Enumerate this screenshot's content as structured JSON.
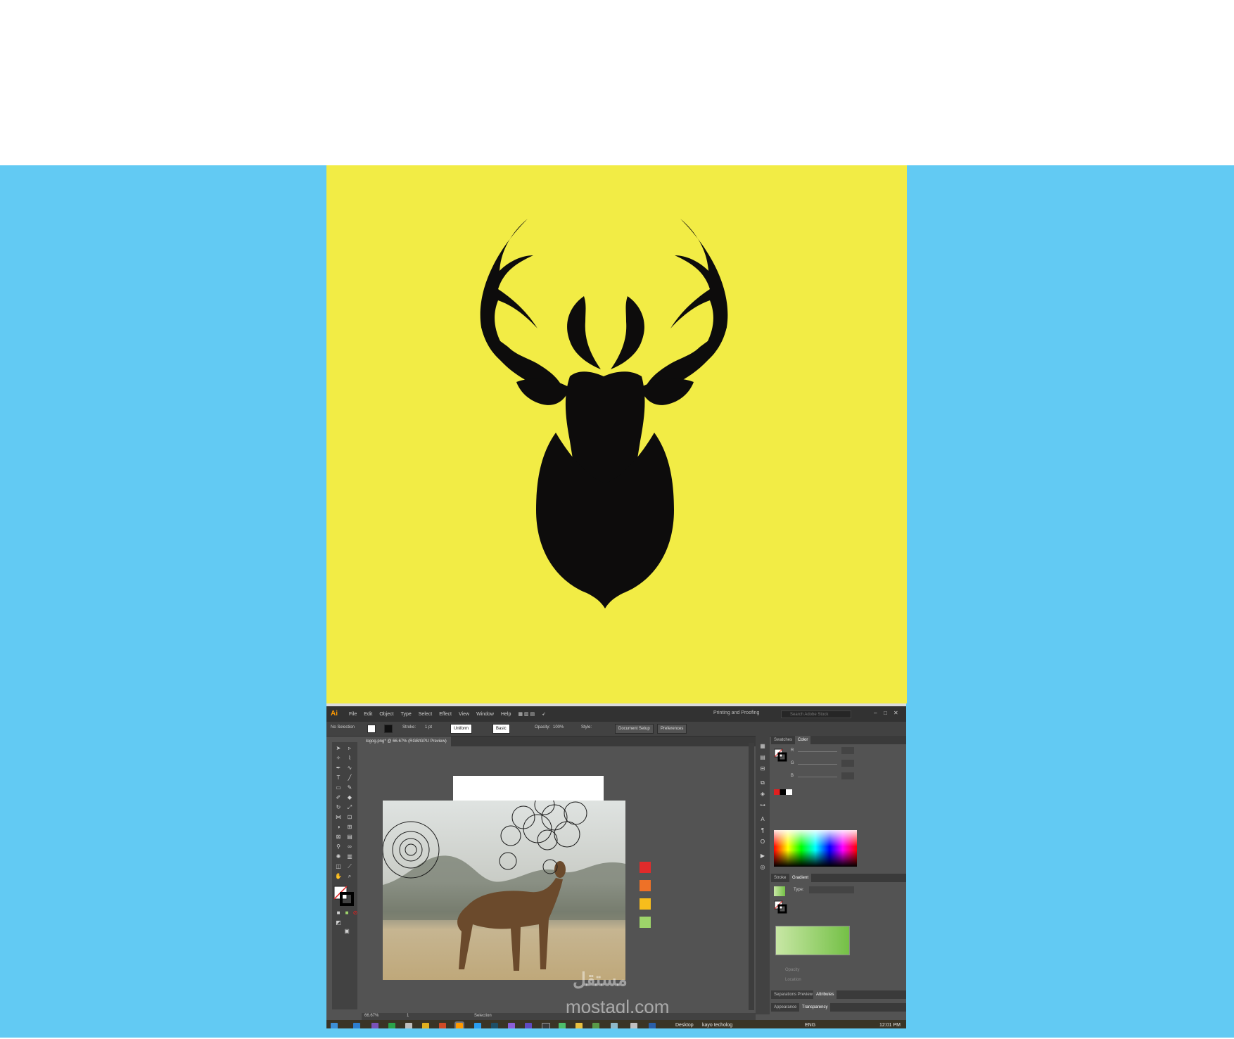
{
  "colors": {
    "page_background": "#ffffff",
    "band": "#62caf3",
    "card": "#f2ec45",
    "deer": "#0d0c0c"
  },
  "illustrator": {
    "app_logo": "Ai",
    "menu": [
      "File",
      "Edit",
      "Object",
      "Type",
      "Select",
      "Effect",
      "View",
      "Window",
      "Help"
    ],
    "workspace": "Printing and Proofing",
    "search_placeholder": "Search Adobe Stock",
    "control_bar": {
      "selection": "No Selection",
      "stroke_label": "Stroke:",
      "stroke_value": "1 pt",
      "profile": "Uniform",
      "brush": "Basic",
      "opacity_label": "Opacity:",
      "opacity_value": "100%",
      "style_label": "Style:",
      "document_setup": "Document Setup",
      "preferences": "Preferences"
    },
    "document_tab": "logog.png* @ 66.67% (RGB/GPU Preview)",
    "panels": {
      "top_tabs": [
        "Swatches",
        "Color"
      ],
      "rgb_labels": [
        "R",
        "G",
        "B"
      ],
      "mid_tabs": [
        "Stroke",
        "Gradient"
      ],
      "gradient_type_label": "Type:",
      "opacity_label": "Opacity",
      "location_label": "Location",
      "bottom_tabs_1": [
        "Separations Preview",
        "Attributes"
      ],
      "bottom_tabs_2": [
        "Appearance",
        "Transparency"
      ]
    },
    "status": {
      "zoom": "66.67%",
      "artboard": "1",
      "tool": "Selection"
    },
    "swatch_colors": [
      "#e12b2b",
      "#ee7127",
      "#f7bd1c",
      "#9dd46a"
    ],
    "watermark": "mostaql.com",
    "taskbar": {
      "desktop_label": "Desktop",
      "window_label": "kayo techolog",
      "language": "ENG",
      "time": "12:01 PM"
    }
  }
}
